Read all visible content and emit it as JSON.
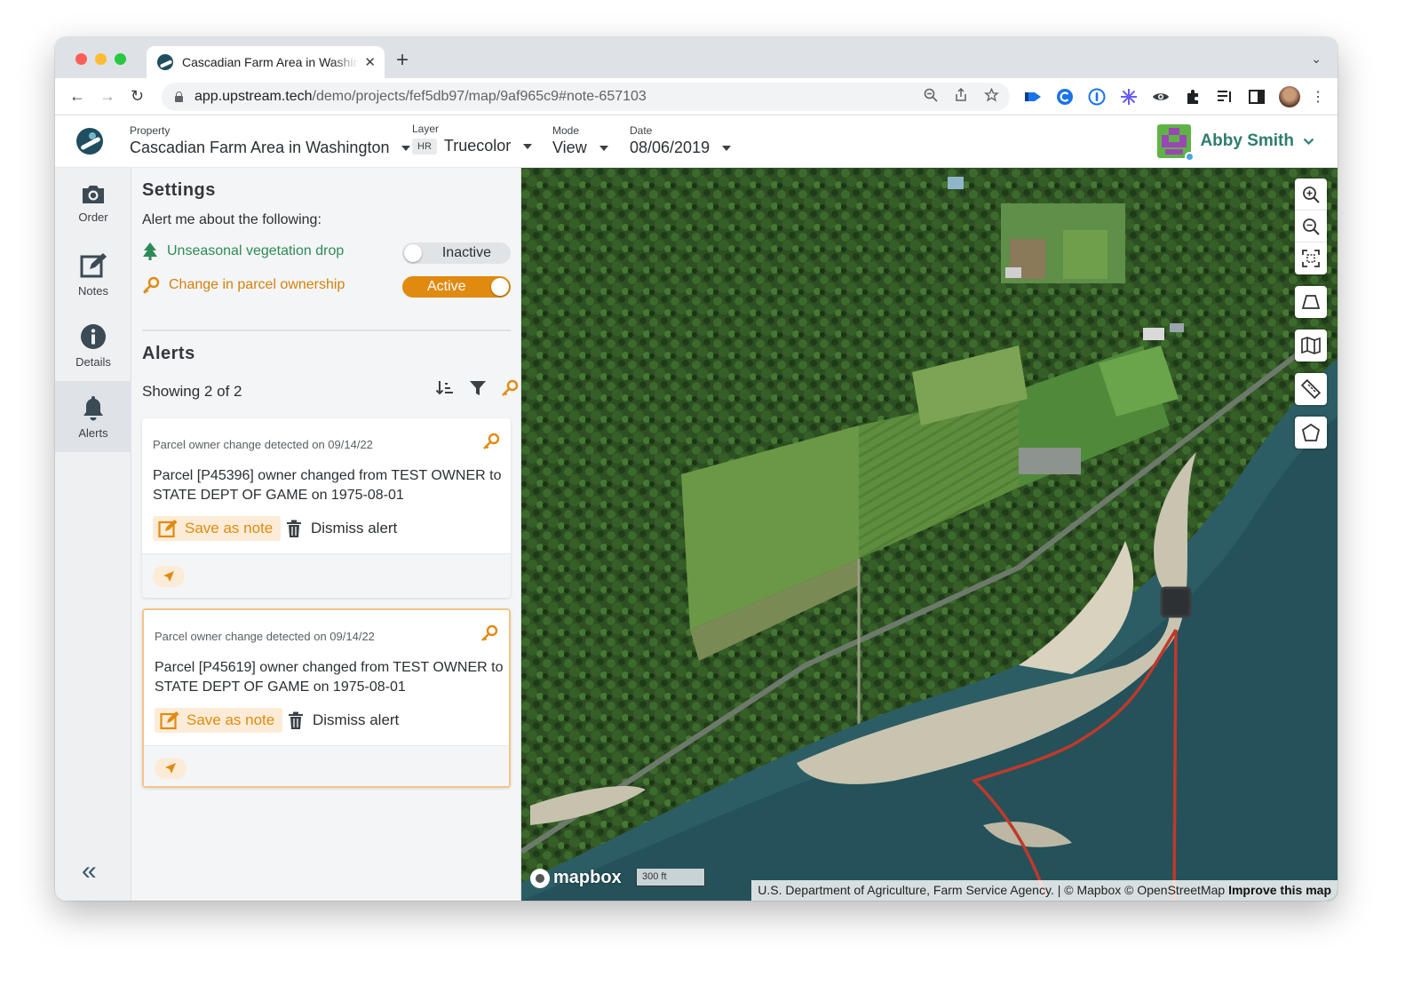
{
  "browser": {
    "tab_title": "Cascadian Farm Area in Washington",
    "url_host": "app.upstream.tech",
    "url_path": "/demo/projects/fef5db97/map/9af965c9#note-657103",
    "new_tab_label": "+"
  },
  "header": {
    "property_caption": "Property",
    "property_value": "Cascadian Farm Area in Washington",
    "layer_caption": "Layer",
    "layer_badge": "HR",
    "layer_value": "Truecolor",
    "mode_caption": "Mode",
    "mode_value": "View",
    "date_caption": "Date",
    "date_value": "08/06/2019",
    "user_name": "Abby Smith"
  },
  "rail": {
    "items": [
      {
        "label": "Order",
        "icon": "camera-icon"
      },
      {
        "label": "Notes",
        "icon": "edit-icon"
      },
      {
        "label": "Details",
        "icon": "info-icon"
      },
      {
        "label": "Alerts",
        "icon": "bell-icon",
        "active": true
      }
    ],
    "collapse_label": "«"
  },
  "settings": {
    "title": "Settings",
    "subtitle": "Alert me about the following:",
    "rules": [
      {
        "label": "Unseasonal vegetation drop",
        "state": "Inactive",
        "enabled": false,
        "color": "#2e8b57"
      },
      {
        "label": "Change in parcel ownership",
        "state": "Active",
        "enabled": true,
        "color": "#d4800f"
      }
    ]
  },
  "alerts": {
    "title": "Alerts",
    "showing": "Showing 2 of 2",
    "save_label": "Save as note",
    "dismiss_label": "Dismiss alert",
    "items": [
      {
        "meta": "Parcel owner change detected on 09/14/22",
        "body": "Parcel [P45396] owner changed from TEST OWNER to STATE DEPT OF GAME on 1975-08-01",
        "selected": false
      },
      {
        "meta": "Parcel owner change detected on 09/14/22",
        "body": "Parcel [P45619] owner changed from TEST OWNER to STATE DEPT OF GAME on 1975-08-01",
        "selected": true
      }
    ]
  },
  "map": {
    "logo_text": "mapbox",
    "scale_label": "300 ft",
    "attribution": "U.S. Department of Agriculture, Farm Service Agency. | © Mapbox © OpenStreetMap",
    "improve_link": "Improve this map",
    "boundary_color": "#c0392b"
  },
  "colors": {
    "accent_orange": "#e08a10",
    "accent_green": "#2e8b57",
    "brand_teal": "#2e7d6f"
  }
}
